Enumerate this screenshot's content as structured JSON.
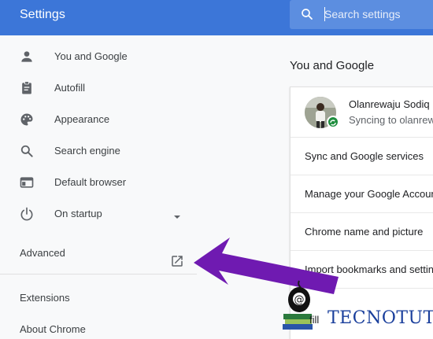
{
  "header": {
    "title": "Settings",
    "search_placeholder": "Search settings",
    "colors": {
      "bar": "#3c76d8",
      "search": "#5c8ee0"
    }
  },
  "sidebar": {
    "items": [
      {
        "label": "You and Google",
        "icon": "person-icon"
      },
      {
        "label": "Autofill",
        "icon": "clipboard-icon"
      },
      {
        "label": "Appearance",
        "icon": "palette-icon"
      },
      {
        "label": "Search engine",
        "icon": "search-icon"
      },
      {
        "label": "Default browser",
        "icon": "browser-window-icon"
      },
      {
        "label": "On startup",
        "icon": "power-icon"
      }
    ],
    "advanced_label": "Advanced",
    "extensions_label": "Extensions",
    "about_label": "About Chrome"
  },
  "main": {
    "heading": "You and Google",
    "profile": {
      "name": "Olanrewaju Sodiq",
      "status": "Syncing to olanrewaju"
    },
    "rows": [
      "Sync and Google services",
      "Manage your Google Account",
      "Chrome name and picture",
      "Import bookmarks and settings"
    ],
    "behind_text": "fill"
  },
  "annotation": {
    "arrow_color": "#6f1ab1"
  },
  "watermark": {
    "text": "TECNOTUTO",
    "color": "#1a3f9c"
  }
}
